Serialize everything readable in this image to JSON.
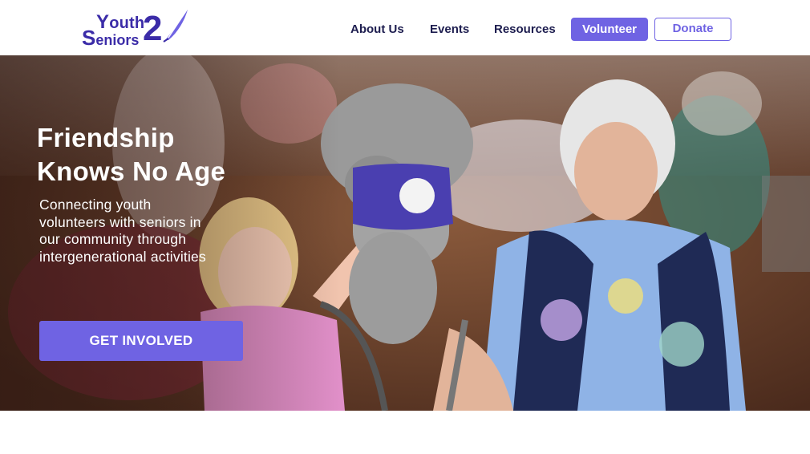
{
  "logo": {
    "youth_cap": "Y",
    "youth_rest": "outh",
    "seniors_cap": "S",
    "seniors_rest": "eniors",
    "numeral": "2",
    "alt": "Youth Seniors 2 logo"
  },
  "nav": {
    "about": "About Us",
    "events": "Events",
    "resources": "Resources",
    "volunteer": "Volunteer",
    "donate": "Donate"
  },
  "hero": {
    "title_line1": "Friendship",
    "title_line2": "Knows No Age",
    "subtitle": "Connecting youth volunteers with seniors in our community through intergenerational activities",
    "cta": "GET INVOLVED"
  },
  "colors": {
    "brand_purple": "#6f63e3",
    "logo_navy": "#3b2ca8",
    "nav_text": "#1d1d4f"
  },
  "icons": {
    "logo_mark": "quill-pen-icon"
  }
}
